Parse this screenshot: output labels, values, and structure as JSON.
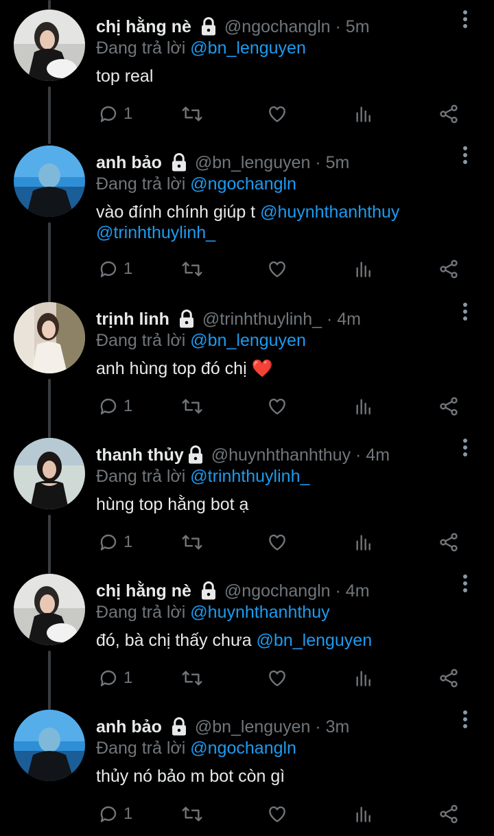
{
  "colors": {
    "background": "#000000",
    "text": "#e7e9ea",
    "muted": "#71767b",
    "accent": "#1d9bf0",
    "heart_emoji": "#e0245e"
  },
  "replying_prefix": "Đang trả lời",
  "tweets": [
    {
      "name": "chị hằng nè",
      "handle": "@ngochangln",
      "time": "· 5m",
      "reply_to": "@bn_lenguyen",
      "text": "top real",
      "text_mention": "",
      "text_line2": "",
      "emoji": "",
      "reply_count": "1",
      "lock_icon": "lock-icon"
    },
    {
      "name": "anh bảo",
      "handle": "@bn_lenguyen",
      "time": "· 5m",
      "reply_to": "@ngochangln",
      "text": "vào đính chính giúp t ",
      "text_mention": "@huynhthanhthuy",
      "text_line2": "@trinhthuylinh_",
      "emoji": "",
      "reply_count": "1",
      "lock_icon": "lock-icon"
    },
    {
      "name": "trịnh linh",
      "handle": "@trinhthuylinh_",
      "time": "· 4m",
      "reply_to": "@bn_lenguyen",
      "text": "anh hùng top đó chị ",
      "text_mention": "",
      "text_line2": "",
      "emoji": "❤️",
      "reply_count": "1",
      "lock_icon": "lock-icon"
    },
    {
      "name": "thanh thủy",
      "handle": "@huynhthanhthuy",
      "time": "· 4m",
      "reply_to": "@trinhthuylinh_",
      "text": "hùng top hằng bot ạ",
      "text_mention": "",
      "text_line2": "",
      "emoji": "",
      "reply_count": "1",
      "lock_icon": "lock-icon"
    },
    {
      "name": "chị hằng nè",
      "handle": "@ngochangln",
      "time": "· 4m",
      "reply_to": "@huynhthanhthuy",
      "text": "đó, bà chị thấy chưa ",
      "text_mention": "@bn_lenguyen",
      "text_line2": "",
      "emoji": "",
      "reply_count": "1",
      "lock_icon": "lock-icon"
    },
    {
      "name": "anh bảo",
      "handle": "@bn_lenguyen",
      "time": "· 3m",
      "reply_to": "@ngochangln",
      "text": "thủy nó bảo m bot còn gì",
      "text_mention": "",
      "text_line2": "",
      "emoji": "",
      "reply_count": "1",
      "lock_icon": "lock-icon"
    }
  ]
}
